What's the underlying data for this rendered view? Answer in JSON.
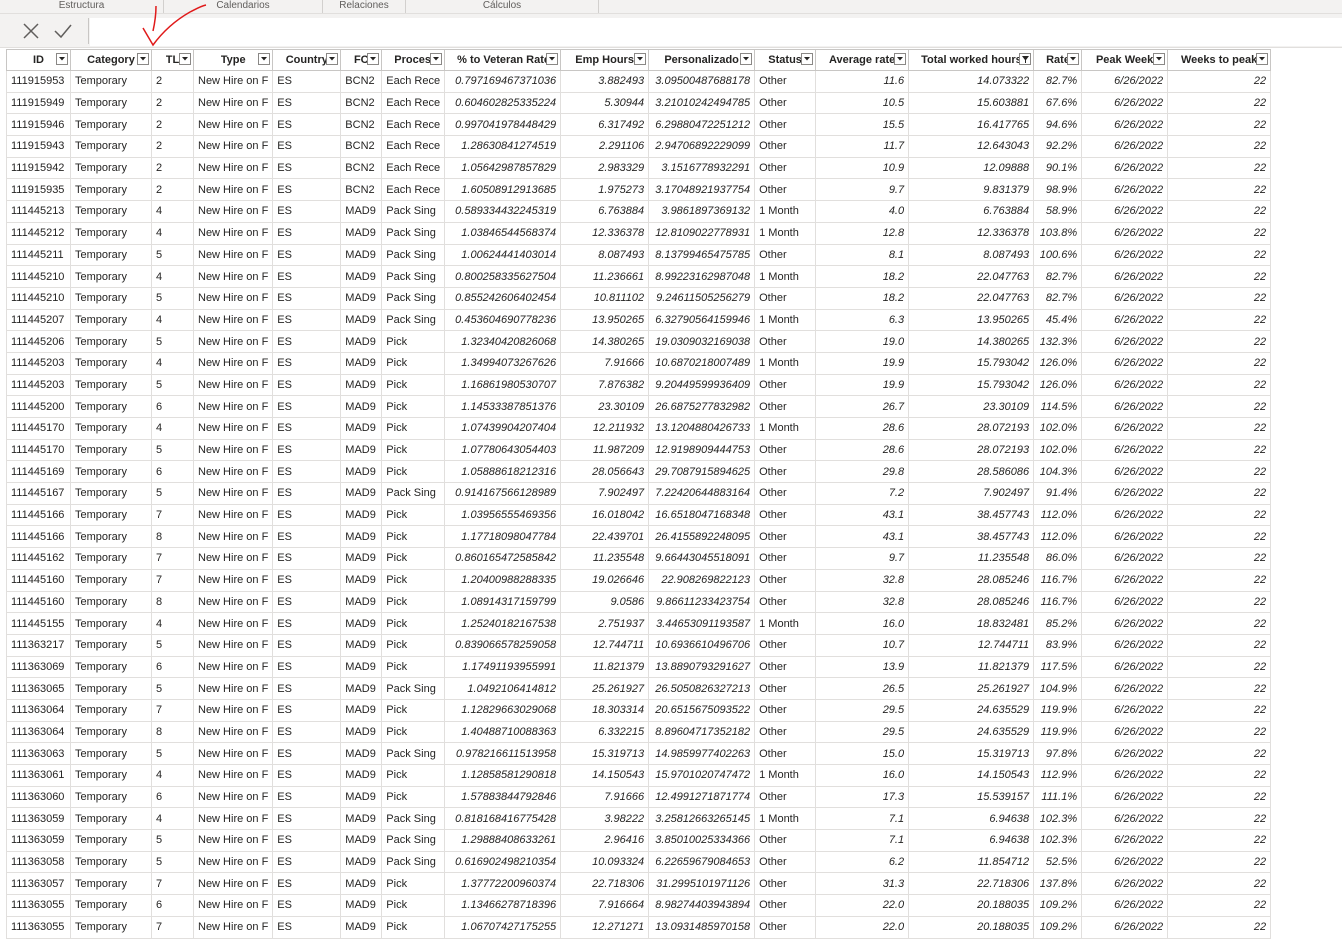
{
  "ribbon": {
    "tabs": [
      "Estructura",
      "Calendarios",
      "Relaciones",
      "Cálculos"
    ]
  },
  "formula_bar": {
    "cancel_label": "✕",
    "commit_label": "✓",
    "value": ""
  },
  "table": {
    "columns": [
      "ID",
      "Category",
      "TL",
      "Type",
      "Country",
      "FC",
      "Process",
      "% to Veteran Rate",
      "Emp Hours",
      "Personalizado",
      "Status",
      "Average rate",
      "Total worked hours",
      "Rate",
      "Peak Week",
      "Weeks to peak"
    ],
    "sorted_column": "Total worked hours",
    "rows": [
      [
        "111915953",
        "Temporary",
        "2",
        "New Hire on F",
        "ES",
        "BCN2",
        "Each Rece",
        "0.797169467371036",
        "3.882493",
        "3.09500487688178",
        "Other",
        "11.6",
        "14.073322",
        "82.7%",
        "6/26/2022",
        "22"
      ],
      [
        "111915949",
        "Temporary",
        "2",
        "New Hire on F",
        "ES",
        "BCN2",
        "Each Rece",
        "0.604602825335224",
        "5.30944",
        "3.21010242494785",
        "Other",
        "10.5",
        "15.603881",
        "67.6%",
        "6/26/2022",
        "22"
      ],
      [
        "111915946",
        "Temporary",
        "2",
        "New Hire on F",
        "ES",
        "BCN2",
        "Each Rece",
        "0.997041978448429",
        "6.317492",
        "6.29880472251212",
        "Other",
        "15.5",
        "16.417765",
        "94.6%",
        "6/26/2022",
        "22"
      ],
      [
        "111915943",
        "Temporary",
        "2",
        "New Hire on F",
        "ES",
        "BCN2",
        "Each Rece",
        "1.28630841274519",
        "2.291106",
        "2.94706892229099",
        "Other",
        "11.7",
        "12.643043",
        "92.2%",
        "6/26/2022",
        "22"
      ],
      [
        "111915942",
        "Temporary",
        "2",
        "New Hire on F",
        "ES",
        "BCN2",
        "Each Rece",
        "1.05642987857829",
        "2.983329",
        "3.1516778932291",
        "Other",
        "10.9",
        "12.09888",
        "90.1%",
        "6/26/2022",
        "22"
      ],
      [
        "111915935",
        "Temporary",
        "2",
        "New Hire on F",
        "ES",
        "BCN2",
        "Each Rece",
        "1.60508912913685",
        "1.975273",
        "3.17048921937754",
        "Other",
        "9.7",
        "9.831379",
        "98.9%",
        "6/26/2022",
        "22"
      ],
      [
        "111445213",
        "Temporary",
        "4",
        "New Hire on F",
        "ES",
        "MAD9",
        "Pack Sing",
        "0.589334432245319",
        "6.763884",
        "3.9861897369132",
        "1 Month",
        "4.0",
        "6.763884",
        "58.9%",
        "6/26/2022",
        "22"
      ],
      [
        "111445212",
        "Temporary",
        "4",
        "New Hire on F",
        "ES",
        "MAD9",
        "Pack Sing",
        "1.03846544568374",
        "12.336378",
        "12.8109022778931",
        "1 Month",
        "12.8",
        "12.336378",
        "103.8%",
        "6/26/2022",
        "22"
      ],
      [
        "111445211",
        "Temporary",
        "5",
        "New Hire on F",
        "ES",
        "MAD9",
        "Pack Sing",
        "1.00624441403014",
        "8.087493",
        "8.13799465475785",
        "Other",
        "8.1",
        "8.087493",
        "100.6%",
        "6/26/2022",
        "22"
      ],
      [
        "111445210",
        "Temporary",
        "4",
        "New Hire on F",
        "ES",
        "MAD9",
        "Pack Sing",
        "0.800258335627504",
        "11.236661",
        "8.99223162987048",
        "1 Month",
        "18.2",
        "22.047763",
        "82.7%",
        "6/26/2022",
        "22"
      ],
      [
        "111445210",
        "Temporary",
        "5",
        "New Hire on F",
        "ES",
        "MAD9",
        "Pack Sing",
        "0.855242606402454",
        "10.811102",
        "9.24611505256279",
        "Other",
        "18.2",
        "22.047763",
        "82.7%",
        "6/26/2022",
        "22"
      ],
      [
        "111445207",
        "Temporary",
        "4",
        "New Hire on F",
        "ES",
        "MAD9",
        "Pack Sing",
        "0.453604690778236",
        "13.950265",
        "6.32790564159946",
        "1 Month",
        "6.3",
        "13.950265",
        "45.4%",
        "6/26/2022",
        "22"
      ],
      [
        "111445206",
        "Temporary",
        "5",
        "New Hire on F",
        "ES",
        "MAD9",
        "Pick",
        "1.32340420826068",
        "14.380265",
        "19.0309032169038",
        "Other",
        "19.0",
        "14.380265",
        "132.3%",
        "6/26/2022",
        "22"
      ],
      [
        "111445203",
        "Temporary",
        "4",
        "New Hire on F",
        "ES",
        "MAD9",
        "Pick",
        "1.34994073267626",
        "7.91666",
        "10.6870218007489",
        "1 Month",
        "19.9",
        "15.793042",
        "126.0%",
        "6/26/2022",
        "22"
      ],
      [
        "111445203",
        "Temporary",
        "5",
        "New Hire on F",
        "ES",
        "MAD9",
        "Pick",
        "1.16861980530707",
        "7.876382",
        "9.20449599936409",
        "Other",
        "19.9",
        "15.793042",
        "126.0%",
        "6/26/2022",
        "22"
      ],
      [
        "111445200",
        "Temporary",
        "6",
        "New Hire on F",
        "ES",
        "MAD9",
        "Pick",
        "1.14533387851376",
        "23.30109",
        "26.6875277832982",
        "Other",
        "26.7",
        "23.30109",
        "114.5%",
        "6/26/2022",
        "22"
      ],
      [
        "111445170",
        "Temporary",
        "4",
        "New Hire on F",
        "ES",
        "MAD9",
        "Pick",
        "1.07439904207404",
        "12.211932",
        "13.1204880426733",
        "1 Month",
        "28.6",
        "28.072193",
        "102.0%",
        "6/26/2022",
        "22"
      ],
      [
        "111445170",
        "Temporary",
        "5",
        "New Hire on F",
        "ES",
        "MAD9",
        "Pick",
        "1.07780643054403",
        "11.987209",
        "12.9198909444753",
        "Other",
        "28.6",
        "28.072193",
        "102.0%",
        "6/26/2022",
        "22"
      ],
      [
        "111445169",
        "Temporary",
        "6",
        "New Hire on F",
        "ES",
        "MAD9",
        "Pick",
        "1.05888618212316",
        "28.056643",
        "29.7087915894625",
        "Other",
        "29.8",
        "28.586086",
        "104.3%",
        "6/26/2022",
        "22"
      ],
      [
        "111445167",
        "Temporary",
        "5",
        "New Hire on F",
        "ES",
        "MAD9",
        "Pack Sing",
        "0.914167566128989",
        "7.902497",
        "7.22420644883164",
        "Other",
        "7.2",
        "7.902497",
        "91.4%",
        "6/26/2022",
        "22"
      ],
      [
        "111445166",
        "Temporary",
        "7",
        "New Hire on F",
        "ES",
        "MAD9",
        "Pick",
        "1.03956555469356",
        "16.018042",
        "16.6518047168348",
        "Other",
        "43.1",
        "38.457743",
        "112.0%",
        "6/26/2022",
        "22"
      ],
      [
        "111445166",
        "Temporary",
        "8",
        "New Hire on F",
        "ES",
        "MAD9",
        "Pick",
        "1.17718098047784",
        "22.439701",
        "26.4155892248095",
        "Other",
        "43.1",
        "38.457743",
        "112.0%",
        "6/26/2022",
        "22"
      ],
      [
        "111445162",
        "Temporary",
        "7",
        "New Hire on F",
        "ES",
        "MAD9",
        "Pick",
        "0.860165472585842",
        "11.235548",
        "9.66443045518091",
        "Other",
        "9.7",
        "11.235548",
        "86.0%",
        "6/26/2022",
        "22"
      ],
      [
        "111445160",
        "Temporary",
        "7",
        "New Hire on F",
        "ES",
        "MAD9",
        "Pick",
        "1.20400988288335",
        "19.026646",
        "22.908269822123",
        "Other",
        "32.8",
        "28.085246",
        "116.7%",
        "6/26/2022",
        "22"
      ],
      [
        "111445160",
        "Temporary",
        "8",
        "New Hire on F",
        "ES",
        "MAD9",
        "Pick",
        "1.08914317159799",
        "9.0586",
        "9.86611233423754",
        "Other",
        "32.8",
        "28.085246",
        "116.7%",
        "6/26/2022",
        "22"
      ],
      [
        "111445155",
        "Temporary",
        "4",
        "New Hire on F",
        "ES",
        "MAD9",
        "Pick",
        "1.25240182167538",
        "2.751937",
        "3.44653091193587",
        "1 Month",
        "16.0",
        "18.832481",
        "85.2%",
        "6/26/2022",
        "22"
      ],
      [
        "111363217",
        "Temporary",
        "5",
        "New Hire on F",
        "ES",
        "MAD9",
        "Pick",
        "0.839066578259058",
        "12.744711",
        "10.6936610496706",
        "Other",
        "10.7",
        "12.744711",
        "83.9%",
        "6/26/2022",
        "22"
      ],
      [
        "111363069",
        "Temporary",
        "6",
        "New Hire on F",
        "ES",
        "MAD9",
        "Pick",
        "1.17491193955991",
        "11.821379",
        "13.8890793291627",
        "Other",
        "13.9",
        "11.821379",
        "117.5%",
        "6/26/2022",
        "22"
      ],
      [
        "111363065",
        "Temporary",
        "5",
        "New Hire on F",
        "ES",
        "MAD9",
        "Pack Sing",
        "1.0492106414812",
        "25.261927",
        "26.5050826327213",
        "Other",
        "26.5",
        "25.261927",
        "104.9%",
        "6/26/2022",
        "22"
      ],
      [
        "111363064",
        "Temporary",
        "7",
        "New Hire on F",
        "ES",
        "MAD9",
        "Pick",
        "1.12829663029068",
        "18.303314",
        "20.6515675093522",
        "Other",
        "29.5",
        "24.635529",
        "119.9%",
        "6/26/2022",
        "22"
      ],
      [
        "111363064",
        "Temporary",
        "8",
        "New Hire on F",
        "ES",
        "MAD9",
        "Pick",
        "1.40488710088363",
        "6.332215",
        "8.89604717352182",
        "Other",
        "29.5",
        "24.635529",
        "119.9%",
        "6/26/2022",
        "22"
      ],
      [
        "111363063",
        "Temporary",
        "5",
        "New Hire on F",
        "ES",
        "MAD9",
        "Pack Sing",
        "0.978216611513958",
        "15.319713",
        "14.9859977402263",
        "Other",
        "15.0",
        "15.319713",
        "97.8%",
        "6/26/2022",
        "22"
      ],
      [
        "111363061",
        "Temporary",
        "4",
        "New Hire on F",
        "ES",
        "MAD9",
        "Pick",
        "1.12858581290818",
        "14.150543",
        "15.9701020747472",
        "1 Month",
        "16.0",
        "14.150543",
        "112.9%",
        "6/26/2022",
        "22"
      ],
      [
        "111363060",
        "Temporary",
        "6",
        "New Hire on F",
        "ES",
        "MAD9",
        "Pick",
        "1.57883844792846",
        "7.91666",
        "12.4991271871774",
        "Other",
        "17.3",
        "15.539157",
        "111.1%",
        "6/26/2022",
        "22"
      ],
      [
        "111363059",
        "Temporary",
        "4",
        "New Hire on F",
        "ES",
        "MAD9",
        "Pack Sing",
        "0.818168416775428",
        "3.98222",
        "3.25812663265145",
        "1 Month",
        "7.1",
        "6.94638",
        "102.3%",
        "6/26/2022",
        "22"
      ],
      [
        "111363059",
        "Temporary",
        "5",
        "New Hire on F",
        "ES",
        "MAD9",
        "Pack Sing",
        "1.29888408633261",
        "2.96416",
        "3.85010025334366",
        "Other",
        "7.1",
        "6.94638",
        "102.3%",
        "6/26/2022",
        "22"
      ],
      [
        "111363058",
        "Temporary",
        "5",
        "New Hire on F",
        "ES",
        "MAD9",
        "Pack Sing",
        "0.616902498210354",
        "10.093324",
        "6.22659679084653",
        "Other",
        "6.2",
        "11.854712",
        "52.5%",
        "6/26/2022",
        "22"
      ],
      [
        "111363057",
        "Temporary",
        "7",
        "New Hire on F",
        "ES",
        "MAD9",
        "Pick",
        "1.37772200960374",
        "22.718306",
        "31.2995101971126",
        "Other",
        "31.3",
        "22.718306",
        "137.8%",
        "6/26/2022",
        "22"
      ],
      [
        "111363055",
        "Temporary",
        "6",
        "New Hire on F",
        "ES",
        "MAD9",
        "Pick",
        "1.13466278718396",
        "7.916664",
        "8.98274403943894",
        "Other",
        "22.0",
        "20.188035",
        "109.2%",
        "6/26/2022",
        "22"
      ],
      [
        "111363055",
        "Temporary",
        "7",
        "New Hire on F",
        "ES",
        "MAD9",
        "Pick",
        "1.06707427175255",
        "12.271271",
        "13.0931485970158",
        "Other",
        "22.0",
        "20.188035",
        "109.2%",
        "6/26/2022",
        "22"
      ]
    ]
  }
}
